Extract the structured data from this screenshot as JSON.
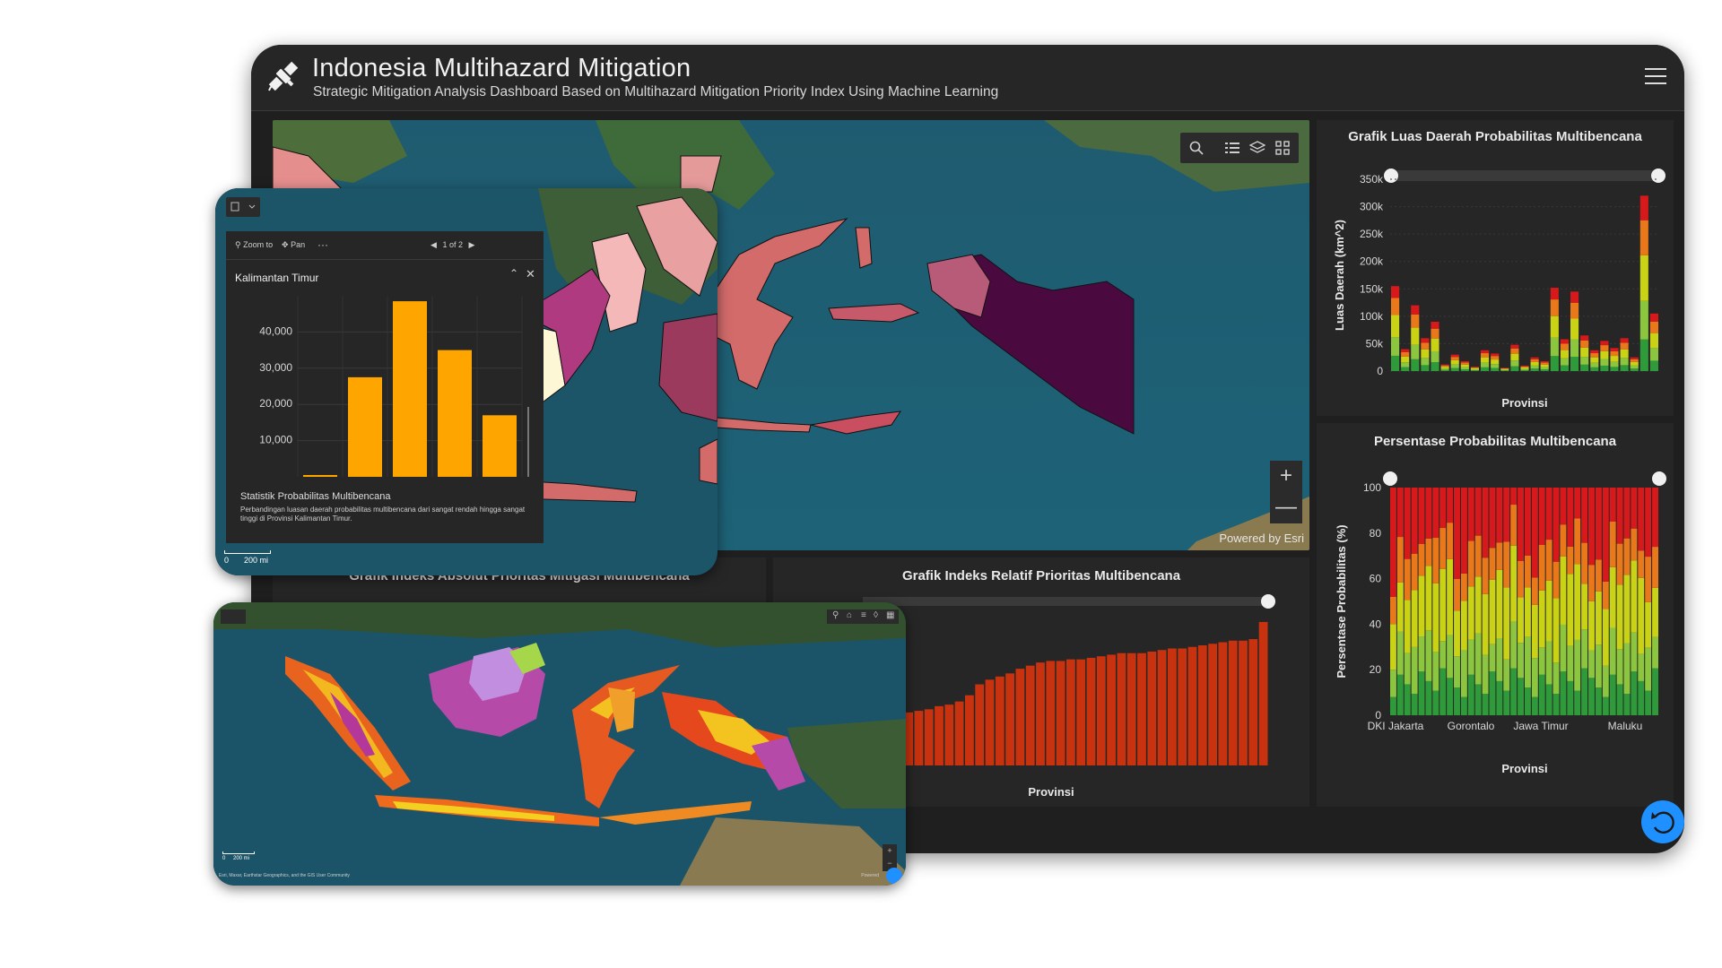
{
  "header": {
    "title": "Indonesia Multihazard Mitigation",
    "subtitle": "Strategic Mitigation Analysis Dashboard Based on Multihazard Mitigation Priority Index Using Machine Learning"
  },
  "map": {
    "credit": "Powered by Esri",
    "zoom_in": "+",
    "zoom_out": "—"
  },
  "panels": {
    "area_chart_title": "Grafik Luas Daerah Probabilitas Multibencana",
    "percent_chart_title": "Persentase Probabilitas Multibencana",
    "absolute_chart_title": "Grafik Indeks Absolut Prioritas Mitigasi Multibencana",
    "relative_chart_title": "Grafik Indeks Relatif Prioritas Multibencana"
  },
  "popup": {
    "zoom_to": "Zoom to",
    "pan": "Pan",
    "more": "···",
    "pager": "1 of 2",
    "feature_title": "Kalimantan Timur",
    "chart_caption": "Statistik Probabilitas Multibencana",
    "chart_description": "Perbandingan luasan daerah probabilitas multibencana dari sangat rendah hingga sangat tinggi di Provinsi Kalimantan Timur.",
    "scale_zero": "0",
    "scale_label": "200 mi"
  },
  "phone": {
    "scale_zero": "0",
    "scale_label": "200 mi",
    "attribution": "Esri, Maxar, Earthstar Geographics, and the GIS User Community",
    "credit": "Powered"
  },
  "colors": {
    "accent": "#1e90ff",
    "bar_orange": "#ffa500",
    "bar_red": "#c8320e",
    "prob_very_high": "#d7191c",
    "prob_high": "#e8781a",
    "prob_medium": "#c9d214",
    "prob_low": "#8cc63f",
    "prob_very_low": "#2e9a3a"
  },
  "chart_data": [
    {
      "id": "area",
      "type": "bar",
      "stacked": true,
      "title": "Grafik Luas Daerah Probabilitas Multibencana",
      "xlabel": "Provinsi",
      "ylabel": "Luas Daerah (km^2)",
      "ylim": [
        0,
        350000
      ],
      "yticks": [
        "0",
        "50k",
        "100k",
        "150k",
        "200k",
        "250k",
        "300k",
        "350k"
      ],
      "ytick_values": [
        0,
        50000,
        100000,
        150000,
        200000,
        250000,
        300000,
        350000
      ],
      "totals": [
        155000,
        40000,
        120000,
        60000,
        90000,
        12000,
        30000,
        18000,
        8000,
        38000,
        32000,
        6000,
        48000,
        10000,
        25000,
        18000,
        152000,
        58000,
        145000,
        65000,
        38000,
        55000,
        42000,
        60000,
        25000,
        320000,
        105000
      ]
    },
    {
      "id": "percent",
      "type": "bar",
      "stacked": true,
      "title": "Persentase Probabilitas Multibencana",
      "xlabel": "Provinsi",
      "ylabel": "Persentase Probabilitas (%)",
      "ylim": [
        0,
        100
      ],
      "yticks": [
        "0",
        "20",
        "40",
        "60",
        "80",
        "100"
      ],
      "ytick_values": [
        0,
        20,
        40,
        60,
        80,
        100
      ],
      "xticks": [
        "DKI Jakarta",
        "Gorontalo",
        "Jawa Timur",
        "Maluku"
      ]
    },
    {
      "id": "relative",
      "type": "bar",
      "title": "Grafik Indeks Relatif Prioritas Multibencana",
      "xlabel": "Provinsi",
      "values": [
        0.2,
        0.22,
        0.3,
        0.32,
        0.34,
        0.35,
        0.36,
        0.38,
        0.39,
        0.41,
        0.45,
        0.52,
        0.55,
        0.57,
        0.59,
        0.62,
        0.64,
        0.66,
        0.67,
        0.67,
        0.68,
        0.68,
        0.69,
        0.7,
        0.71,
        0.72,
        0.72,
        0.72,
        0.73,
        0.74,
        0.75,
        0.75,
        0.76,
        0.77,
        0.78,
        0.79,
        0.8,
        0.8,
        0.81,
        0.92
      ]
    },
    {
      "id": "kaltim",
      "type": "bar",
      "title": "Kalimantan Timur",
      "yticks": [
        "10,000",
        "20,000",
        "30,000",
        "40,000"
      ],
      "ytick_values": [
        10000,
        20000,
        30000,
        40000
      ],
      "ylim": [
        0,
        50000
      ],
      "values": [
        500,
        27500,
        48500,
        35000,
        17000
      ]
    }
  ]
}
